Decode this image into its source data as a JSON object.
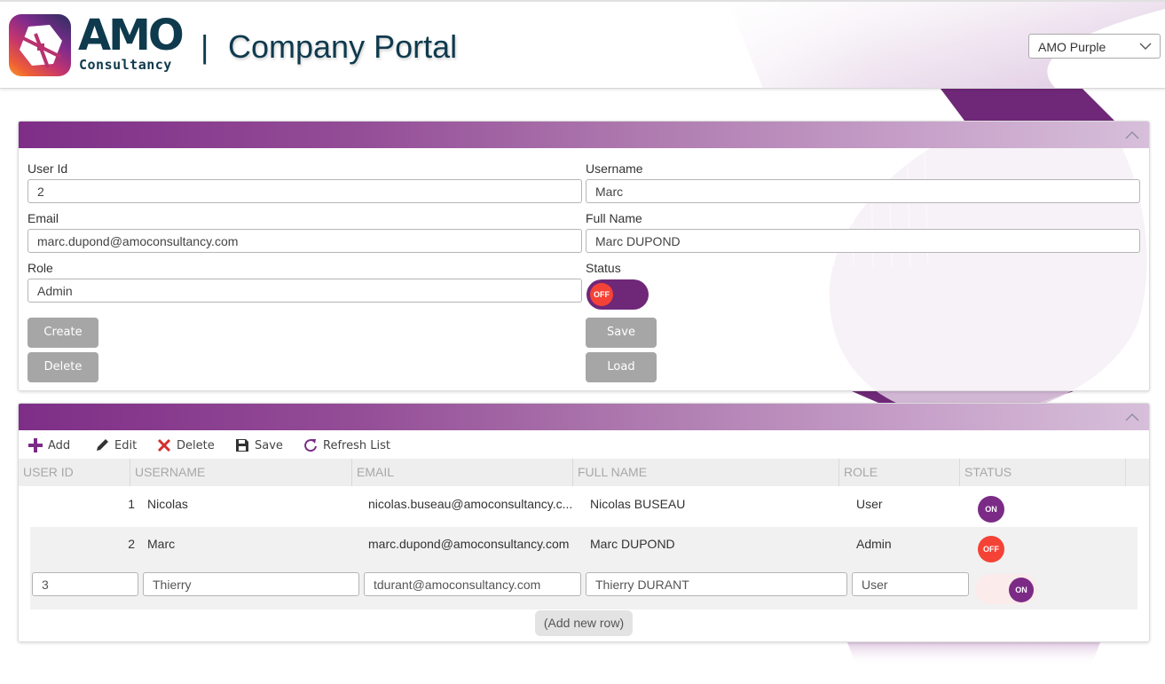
{
  "header": {
    "logo_text": "AMO",
    "logo_subtext": "Consultancy",
    "separator": "|",
    "app_title": "Company Portal",
    "theme_select": {
      "selected": "AMO Purple"
    }
  },
  "form": {
    "fields": {
      "user_id": {
        "label": "User Id",
        "value": "2"
      },
      "username": {
        "label": "Username",
        "value": "Marc"
      },
      "email": {
        "label": "Email",
        "value": "marc.dupond@amoconsultancy.com"
      },
      "full_name": {
        "label": "Full Name",
        "value": "Marc DUPOND"
      },
      "role": {
        "label": "Role",
        "value": "Admin"
      },
      "status": {
        "label": "Status",
        "value": "OFF"
      }
    },
    "buttons": {
      "create": "Create",
      "delete": "Delete",
      "save": "Save",
      "load": "Load"
    }
  },
  "grid": {
    "toolbar": {
      "add": "Add",
      "edit": "Edit",
      "delete": "Delete",
      "save": "Save",
      "refresh": "Refresh List"
    },
    "columns": [
      "USER ID",
      "USERNAME",
      "EMAIL",
      "FULL NAME",
      "ROLE",
      "STATUS"
    ],
    "rows": [
      {
        "user_id": "1",
        "username": "Nicolas",
        "email": "nicolas.buseau@amoconsultancy.c...",
        "full_name": "Nicolas BUSEAU",
        "role": "User",
        "status": "ON"
      },
      {
        "user_id": "2",
        "username": "Marc",
        "email": "marc.dupond@amoconsultancy.com",
        "full_name": "Marc DUPOND",
        "role": "Admin",
        "status": "OFF"
      }
    ],
    "edit_row": {
      "user_id": "3",
      "username": "Thierry",
      "email": "tdurant@amoconsultancy.com",
      "full_name": "Thierry DURANT",
      "role": "User",
      "status": "ON"
    },
    "add_new_row": "(Add new row)"
  },
  "colors": {
    "brand_purple": "#7b2b86",
    "toggle_track": "#6f2878",
    "status_off": "#f44336",
    "title_navy": "#0f3a4e",
    "button_gray": "#a6a6a6"
  }
}
